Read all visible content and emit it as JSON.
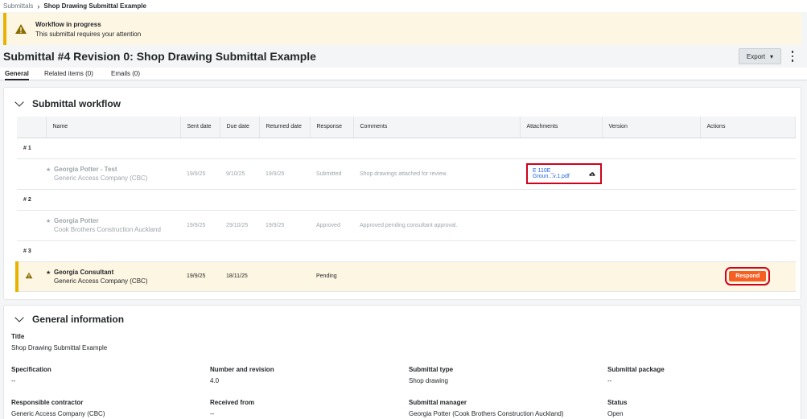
{
  "breadcrumb": {
    "parent": "Submittals",
    "current": "Shop Drawing Submittal Example"
  },
  "banner": {
    "title": "Workflow in progress",
    "subtitle": "This submittal requires your attention"
  },
  "page": {
    "title": "Submittal #4 Revision 0: Shop Drawing Submittal Example",
    "export_label": "Export"
  },
  "tabs": [
    "General",
    "Related items (0)",
    "Emails (0)"
  ],
  "workflow": {
    "heading": "Submittal workflow",
    "columns": [
      "Name",
      "Sent date",
      "Due date",
      "Returned date",
      "Response",
      "Comments",
      "Attachments",
      "Version",
      "Actions"
    ],
    "groups": [
      {
        "label": "# 1",
        "name": "Georgia Potter - Test",
        "company": "Generic Access Company (CBC)",
        "sent": "19/9/25",
        "due": "9/10/25",
        "returned": "19/9/25",
        "response": "Submitted",
        "comment": "Shop drawings attached for review.",
        "attachment": "E 110E_ Groun...v.1.pdf"
      },
      {
        "label": "# 2",
        "name": "Georgia Potter",
        "company": "Cook Brothers Construction Auckland",
        "sent": "19/9/25",
        "due": "29/10/25",
        "returned": "19/9/25",
        "response": "Approved",
        "comment": "Approved pending consultant approval."
      },
      {
        "label": "# 3",
        "name": "Georgia Consultant",
        "company": "Generic Access Company (CBC)",
        "sent": "19/9/25",
        "due": "18/11/25",
        "response": "Pending",
        "action": "Respond"
      }
    ]
  },
  "general": {
    "heading": "General information",
    "title_label": "Title",
    "title_value": "Shop Drawing Submittal Example",
    "fields": [
      {
        "label": "Specification",
        "value": "--"
      },
      {
        "label": "Number and revision",
        "value": "4.0"
      },
      {
        "label": "Submittal type",
        "value": "Shop drawing"
      },
      {
        "label": "Submittal package",
        "value": "--"
      },
      {
        "label": "Responsible contractor",
        "value": "Generic Access Company (CBC)"
      },
      {
        "label": "Received from",
        "value": "--"
      },
      {
        "label": "Submittal manager",
        "value": "Georgia Potter (Cook Brothers Construction Auckland)"
      },
      {
        "label": "Status",
        "value": "Open"
      }
    ]
  },
  "colors": {
    "accent": "#f65f22",
    "warning": "#e8b300",
    "highlight": "#d0021b",
    "link": "#2066df"
  }
}
